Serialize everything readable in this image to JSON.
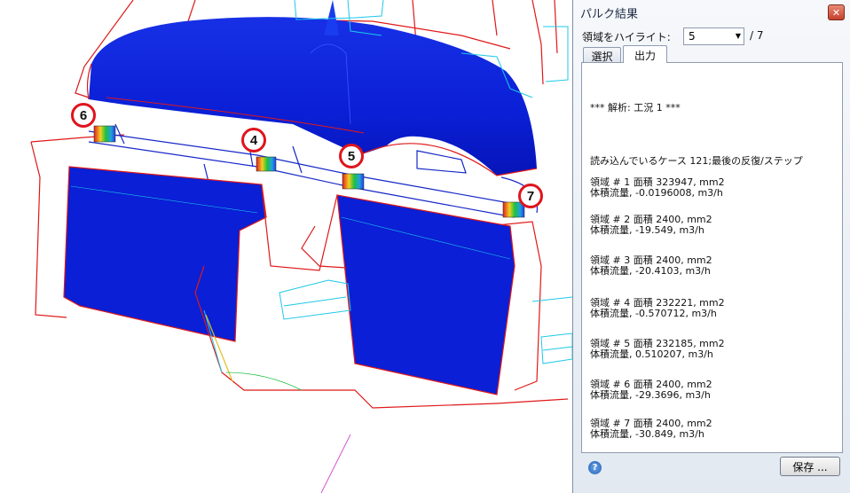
{
  "viewport": {
    "markers": [
      "6",
      "4",
      "5",
      "7"
    ]
  },
  "panel": {
    "title": "パルク結果",
    "close_icon": "close-icon",
    "highlight_label": "領域をハイライト:",
    "highlight_value": "5",
    "highlight_total": "/ 7",
    "tabs": [
      {
        "label": "選択",
        "active": false
      },
      {
        "label": "出力",
        "active": true
      }
    ],
    "output": {
      "analysis": "*** 解析: 工況 1 ***",
      "reading": "読み込んでいるケース 121;最後の反復/ステップ",
      "regions": [
        {
          "area": "領域 # 1 面積  323947, mm2",
          "flow": "体積流量,  -0.0196008, m3/h"
        },
        {
          "area": "領域 # 2 面積  2400, mm2",
          "flow": "体積流量,  -19.549, m3/h"
        },
        {
          "area": "領域 # 3 面積  2400, mm2",
          "flow": "体積流量,  -20.4103, m3/h"
        },
        {
          "area": "領域 # 4 面積  232221, mm2",
          "flow": "体積流量,  -0.570712, m3/h"
        },
        {
          "area": "領域 # 5 面積  232185, mm2",
          "flow": "体積流量,  0.510207, m3/h"
        },
        {
          "area": "領域 # 6 面積  2400, mm2",
          "flow": "体積流量, -29.3696, m3/h"
        },
        {
          "area": "領域 # 7 面積  2400, mm2",
          "flow": "体積流量,  -30.849, m3/h"
        }
      ]
    },
    "help_icon": "help-icon",
    "save_label": "保存 ..."
  },
  "colors": {
    "surface_blue": "#0a1fd6",
    "outline_red": "#e01818",
    "mesh_cyan": "#1ec8e8",
    "marker_red": "#e0141c"
  }
}
